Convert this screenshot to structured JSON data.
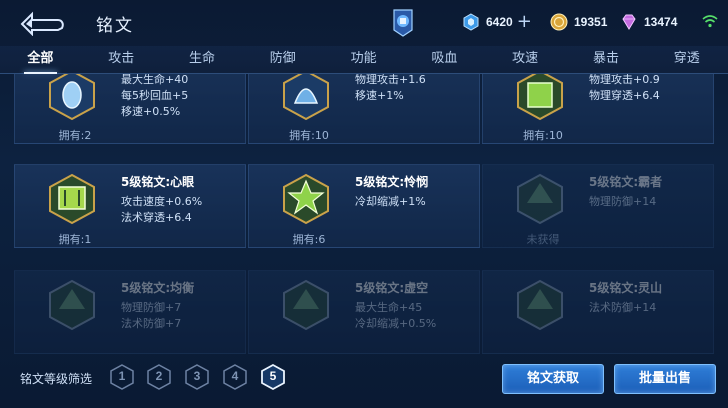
{
  "header": {
    "title": "铭文",
    "currencies": [
      {
        "icon": "diamond-icon",
        "value": "6420"
      },
      {
        "icon": "gold-coin-icon",
        "value": "19351"
      },
      {
        "icon": "gem-icon",
        "value": "13474"
      }
    ]
  },
  "tabs": [
    "全部",
    "攻击",
    "生命",
    "防御",
    "功能",
    "吸血",
    "攻速",
    "暴击",
    "穿透"
  ],
  "cards": [
    {
      "name": "",
      "stats": [
        "最大生命+40",
        "每5秒回血+5",
        "移速+0.5%"
      ],
      "owned": "拥有:2",
      "dim": false,
      "color": "#7fb6e8"
    },
    {
      "name": "",
      "stats": [
        "物理攻击+1.6",
        "移速+1%"
      ],
      "owned": "拥有:10",
      "dim": false,
      "color": "#6fb0e6"
    },
    {
      "name": "",
      "stats": [
        "物理攻击+0.9",
        "物理穿透+6.4"
      ],
      "owned": "拥有:10",
      "dim": false,
      "color": "#8fd24a"
    },
    {
      "name": "5级铭文:心眼",
      "stats": [
        "攻击速度+0.6%",
        "法术穿透+6.4"
      ],
      "owned": "拥有:1",
      "dim": false,
      "color": "#a6d84c"
    },
    {
      "name": "5级铭文:怜悯",
      "stats": [
        "冷却缩减+1%"
      ],
      "owned": "拥有:6",
      "dim": false,
      "color": "#8fd24a"
    },
    {
      "name": "5级铭文:霸者",
      "stats": [
        "物理防御+14"
      ],
      "owned": "未获得",
      "dim": true,
      "color": "#8fd24a"
    },
    {
      "name": "5级铭文:均衡",
      "stats": [
        "物理防御+7",
        "法术防御+7"
      ],
      "owned": "",
      "dim": true,
      "color": "#8fd24a"
    },
    {
      "name": "5级铭文:虚空",
      "stats": [
        "最大生命+45",
        "冷却缩减+0.5%"
      ],
      "owned": "",
      "dim": true,
      "color": "#8fd24a"
    },
    {
      "name": "5级铭文:灵山",
      "stats": [
        "法术防御+14"
      ],
      "owned": "",
      "dim": true,
      "color": "#8fd24a"
    }
  ],
  "footer": {
    "filter_label": "铭文等级筛选",
    "levels": [
      "1",
      "2",
      "3",
      "4",
      "5"
    ],
    "active_level": "5",
    "get_button": "铭文获取",
    "sell_button": "批量出售"
  },
  "colors": {
    "accent": "#2f7ed8",
    "background": "#0d2240",
    "rune_green": "#8fd24a"
  }
}
